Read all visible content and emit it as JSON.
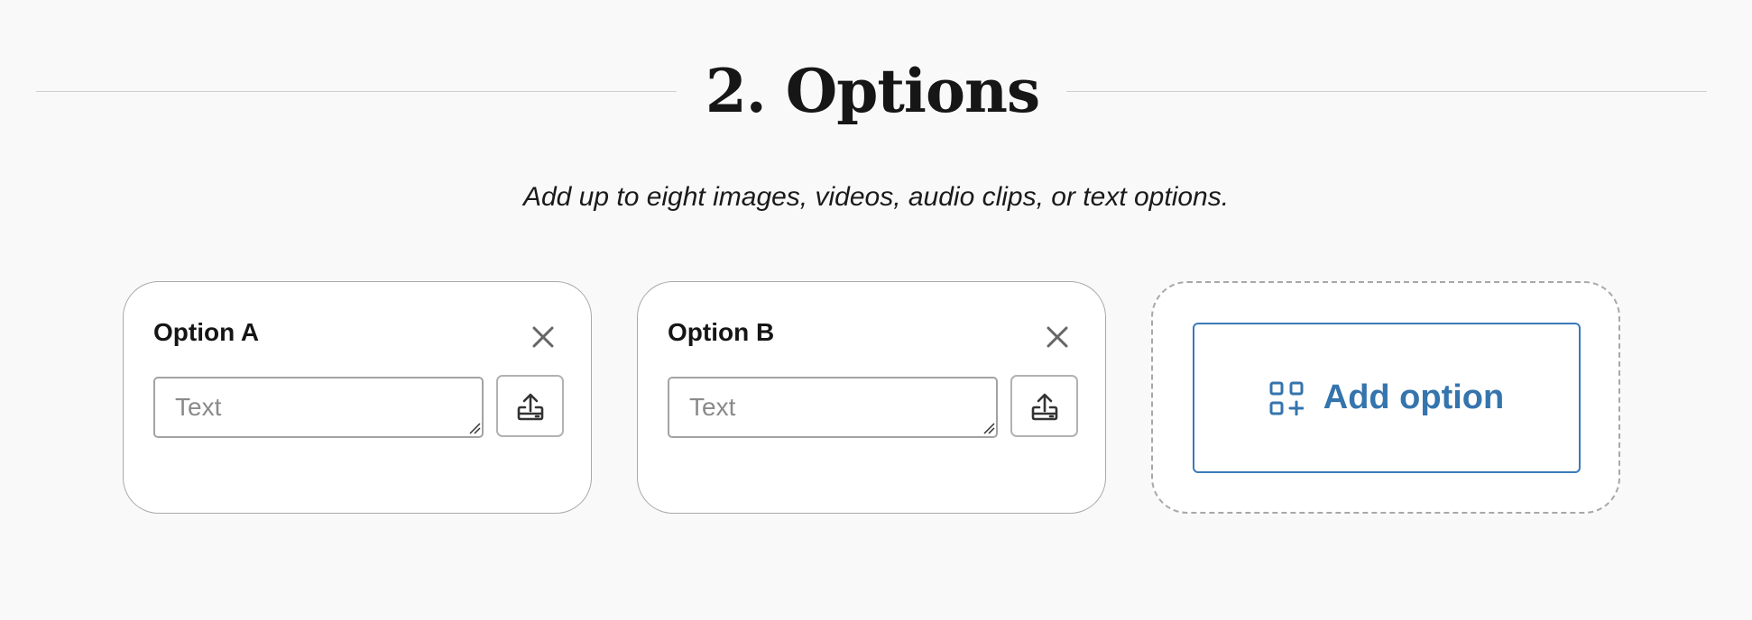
{
  "section": {
    "title": "2. Options",
    "subtitle": "Add up to eight images, videos, audio clips, or text options."
  },
  "options": [
    {
      "title": "Option A",
      "input_placeholder": "Text",
      "input_value": "",
      "upload_icon": "upload-icon",
      "close_icon": "close-icon"
    },
    {
      "title": "Option B",
      "input_placeholder": "Text",
      "input_value": "",
      "upload_icon": "upload-icon",
      "close_icon": "close-icon"
    }
  ],
  "add_option": {
    "label": "Add option",
    "icon": "add-grid-icon"
  },
  "colors": {
    "page_background": "#f9f9f9",
    "card_border": "#a9a9a9",
    "accent_blue": "#3574ad",
    "text_dark": "#151515",
    "placeholder": "#8a8a8a",
    "icon_grey": "#666666"
  }
}
